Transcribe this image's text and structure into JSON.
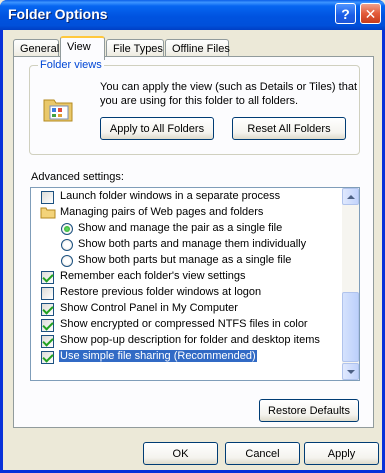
{
  "window": {
    "title": "Folder Options",
    "help_glyph": "?",
    "close_glyph": "✕"
  },
  "tabs": [
    {
      "label": "General",
      "active": false
    },
    {
      "label": "View",
      "active": true
    },
    {
      "label": "File Types",
      "active": false
    },
    {
      "label": "Offline Files",
      "active": false
    }
  ],
  "folder_views": {
    "legend": "Folder views",
    "description": "You can apply the view (such as Details or Tiles) that you are using for this folder to all folders.",
    "apply_all_label": "Apply to All Folders",
    "reset_all_label": "Reset All Folders"
  },
  "advanced": {
    "label": "Advanced settings:",
    "items": [
      {
        "kind": "checkbox",
        "label": "Launch folder windows in a separate process",
        "checked": false
      },
      {
        "kind": "folder",
        "label": "Managing pairs of Web pages and folders"
      },
      {
        "kind": "radio",
        "label": "Show and manage the pair as a single file",
        "checked": true
      },
      {
        "kind": "radio",
        "label": "Show both parts and manage them individually",
        "checked": false
      },
      {
        "kind": "radio",
        "label": "Show both parts but manage as a single file",
        "checked": false
      },
      {
        "kind": "checkbox",
        "label": "Remember each folder's view settings",
        "checked": true
      },
      {
        "kind": "checkbox",
        "label": "Restore previous folder windows at logon",
        "checked": false
      },
      {
        "kind": "checkbox",
        "label": "Show Control Panel in My Computer",
        "checked": true
      },
      {
        "kind": "checkbox",
        "label": "Show encrypted or compressed NTFS files in color",
        "checked": true
      },
      {
        "kind": "checkbox",
        "label": "Show pop-up description for folder and desktop items",
        "checked": true
      },
      {
        "kind": "checkbox",
        "label": "Use simple file sharing (Recommended)",
        "checked": true,
        "selected": true
      }
    ],
    "restore_defaults_label": "Restore Defaults"
  },
  "footer": {
    "ok_label": "OK",
    "cancel_label": "Cancel",
    "apply_label": "Apply"
  },
  "colors": {
    "title_bar": "#0054e3",
    "dialog_bg": "#ece9d8",
    "selection": "#316ac5",
    "check_mark": "#21a121"
  }
}
